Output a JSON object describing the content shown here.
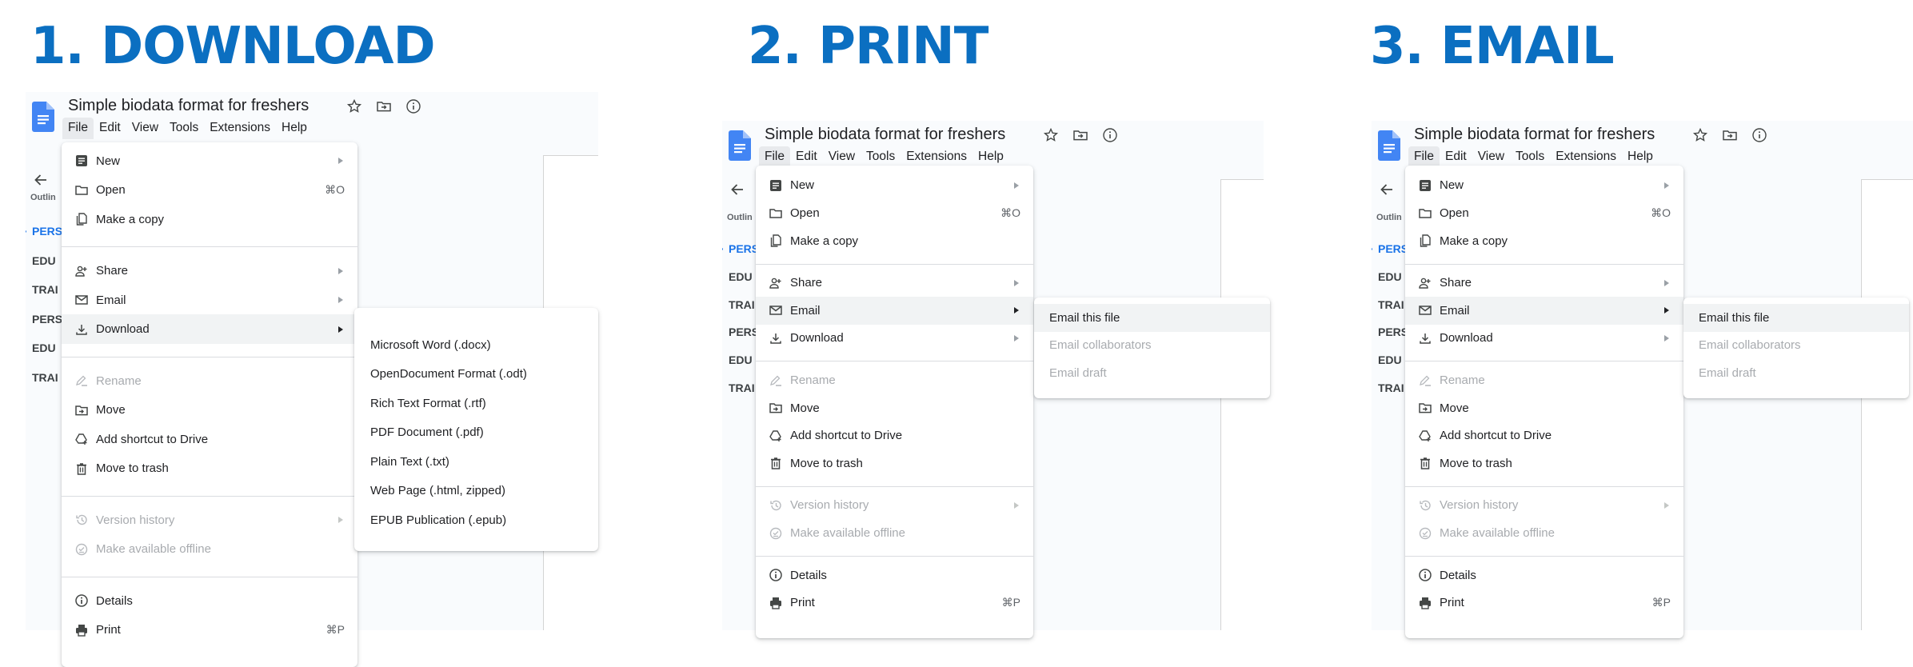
{
  "steps": [
    {
      "title": "1. DOWNLOAD",
      "doc": {
        "title": "Simple biodata format for freshers",
        "menubar": [
          "File",
          "Edit",
          "View",
          "Tools",
          "Extensions",
          "Help"
        ],
        "active_menu": "File",
        "outline_label": "Outlin",
        "outline_items": [
          "PERS",
          "EDU",
          "TRAI",
          "PERS",
          "EDU",
          "TRAI"
        ]
      },
      "file_menu_highlight": "Download",
      "submenu": {
        "parent": "Download",
        "items": [
          {
            "label": "Microsoft Word (.docx)",
            "disabled": false
          },
          {
            "label": "OpenDocument Format (.odt)",
            "disabled": false
          },
          {
            "label": "Rich Text Format (.rtf)",
            "disabled": false
          },
          {
            "label": "PDF Document (.pdf)",
            "disabled": false
          },
          {
            "label": "Plain Text (.txt)",
            "disabled": false
          },
          {
            "label": "Web Page (.html, zipped)",
            "disabled": false
          },
          {
            "label": "EPUB Publication (.epub)",
            "disabled": false
          }
        ]
      }
    },
    {
      "title": "2. PRINT",
      "doc": {
        "title": "Simple biodata format for freshers",
        "menubar": [
          "File",
          "Edit",
          "View",
          "Tools",
          "Extensions",
          "Help"
        ],
        "active_menu": "File",
        "outline_label": "Outlin",
        "outline_items": [
          "PERS",
          "EDU",
          "TRAI",
          "PERS",
          "EDU",
          "TRAI"
        ]
      },
      "file_menu_highlight": "Email",
      "submenu": {
        "parent": "Email",
        "items": [
          {
            "label": "Email this file",
            "disabled": false,
            "highlighted": true
          },
          {
            "label": "Email collaborators",
            "disabled": true
          },
          {
            "label": "Email draft",
            "disabled": true
          }
        ]
      }
    },
    {
      "title": "3. EMAIL",
      "doc": {
        "title": "Simple biodata format for freshers",
        "menubar": [
          "File",
          "Edit",
          "View",
          "Tools",
          "Extensions",
          "Help"
        ],
        "active_menu": "File",
        "outline_label": "Outlin",
        "outline_items": [
          "PERS",
          "EDU",
          "TRAI",
          "PERS",
          "EDU",
          "TRAI"
        ]
      },
      "file_menu_highlight": "Email",
      "submenu": {
        "parent": "Email",
        "items": [
          {
            "label": "Email this file",
            "disabled": false,
            "highlighted": true
          },
          {
            "label": "Email collaborators",
            "disabled": true
          },
          {
            "label": "Email draft",
            "disabled": true
          }
        ]
      }
    }
  ],
  "file_menu": {
    "groups": [
      [
        {
          "label": "New",
          "icon": "new-document-icon",
          "submenu": true,
          "shortcut": "",
          "disabled": false
        },
        {
          "label": "Open",
          "icon": "folder-icon",
          "submenu": false,
          "shortcut": "⌘O",
          "disabled": false
        },
        {
          "label": "Make a copy",
          "icon": "copy-icon",
          "submenu": false,
          "shortcut": "",
          "disabled": false
        }
      ],
      [
        {
          "label": "Share",
          "icon": "share-person-add-icon",
          "submenu": true,
          "shortcut": "",
          "disabled": false
        },
        {
          "label": "Email",
          "icon": "mail-icon",
          "submenu": true,
          "shortcut": "",
          "disabled": false
        },
        {
          "label": "Download",
          "icon": "download-icon",
          "submenu": true,
          "shortcut": "",
          "disabled": false
        }
      ],
      [
        {
          "label": "Rename",
          "icon": "rename-pencil-icon",
          "submenu": false,
          "shortcut": "",
          "disabled": true
        },
        {
          "label": "Move",
          "icon": "move-folder-icon",
          "submenu": false,
          "shortcut": "",
          "disabled": false
        },
        {
          "label": "Add shortcut to Drive",
          "icon": "drive-shortcut-icon",
          "submenu": false,
          "shortcut": "",
          "disabled": false
        },
        {
          "label": "Move to trash",
          "icon": "trash-icon",
          "submenu": false,
          "shortcut": "",
          "disabled": false
        }
      ],
      [
        {
          "label": "Version history",
          "icon": "history-icon",
          "submenu": true,
          "shortcut": "",
          "disabled": true
        },
        {
          "label": "Make available offline",
          "icon": "offline-check-icon",
          "submenu": false,
          "shortcut": "",
          "disabled": true
        }
      ],
      [
        {
          "label": "Details",
          "icon": "info-icon",
          "submenu": false,
          "shortcut": "",
          "disabled": false
        },
        {
          "label": "Print",
          "icon": "printer-icon",
          "submenu": false,
          "shortcut": "⌘P",
          "disabled": false
        }
      ]
    ]
  },
  "colors": {
    "title_blue": "#0B6FC1",
    "docs_blue": "#4285F4",
    "outline_active": "#1A73E8",
    "row_highlight": "#F1F3F4",
    "disabled_text": "#A8ABAF"
  }
}
